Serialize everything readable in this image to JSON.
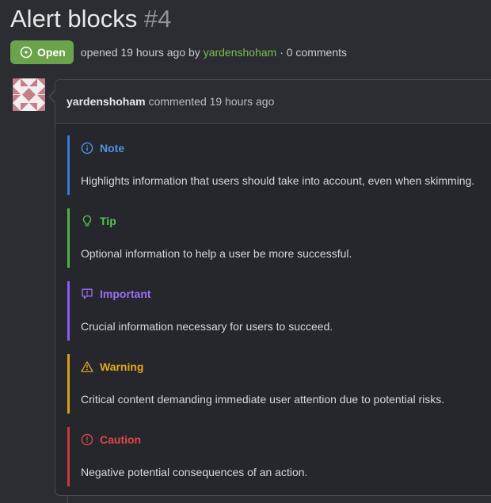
{
  "issue": {
    "title": "Alert blocks",
    "number": "#4",
    "state": "Open",
    "meta_prefix": "opened 19 hours ago by",
    "meta_author": "yardenshoham",
    "meta_suffix": "· 0 comments"
  },
  "comment": {
    "author": "yardenshoham",
    "action": "commented 19 hours ago"
  },
  "alerts": [
    {
      "type": "note",
      "icon": "info-icon",
      "title": "Note",
      "body": "Highlights information that users should take into account, even when skimming.",
      "color": "#3a7bd5"
    },
    {
      "type": "tip",
      "icon": "lightbulb-icon",
      "title": "Tip",
      "body": "Optional information to help a user be more successful.",
      "color": "#4fb24a"
    },
    {
      "type": "important",
      "icon": "report-icon",
      "title": "Important",
      "body": "Crucial information necessary for users to succeed.",
      "color": "#8a5cf5"
    },
    {
      "type": "warning",
      "icon": "alert-triangle-icon",
      "title": "Warning",
      "body": "Critical content demanding immediate user attention due to potential risks.",
      "color": "#d7a21a"
    },
    {
      "type": "caution",
      "icon": "stop-icon",
      "title": "Caution",
      "body": "Negative potential consequences of an action.",
      "color": "#c93a3a"
    }
  ],
  "colors": {
    "background": "#2b2d33",
    "open_badge": "#6aa34a",
    "author_link": "#7bbf4f"
  }
}
